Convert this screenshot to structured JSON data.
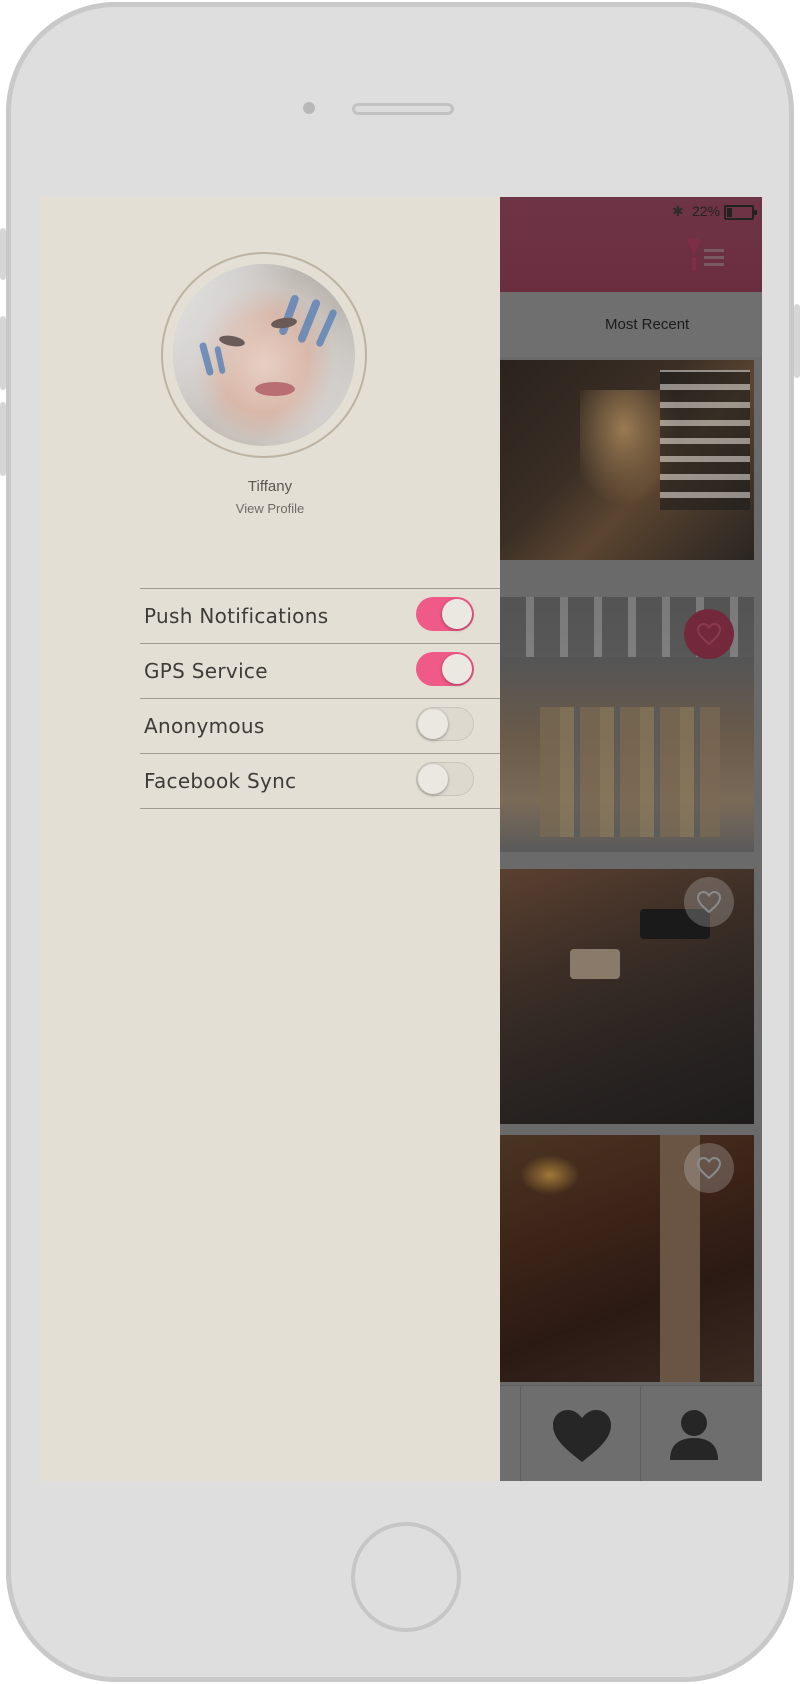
{
  "status_bar": {
    "battery_percent": "22%"
  },
  "app": {
    "tab_label": "Most Recent",
    "brand_color": "#f05a88"
  },
  "profile": {
    "name": "Tiffany",
    "view_profile_label": "View Profile"
  },
  "settings": [
    {
      "label": "Push Notifications",
      "enabled": true
    },
    {
      "label": "GPS Service",
      "enabled": true
    },
    {
      "label": "Anonymous",
      "enabled": false
    },
    {
      "label": "Facebook Sync",
      "enabled": false
    }
  ],
  "bottom_nav": [
    {
      "icon": "heart-icon"
    },
    {
      "icon": "user-icon"
    }
  ]
}
